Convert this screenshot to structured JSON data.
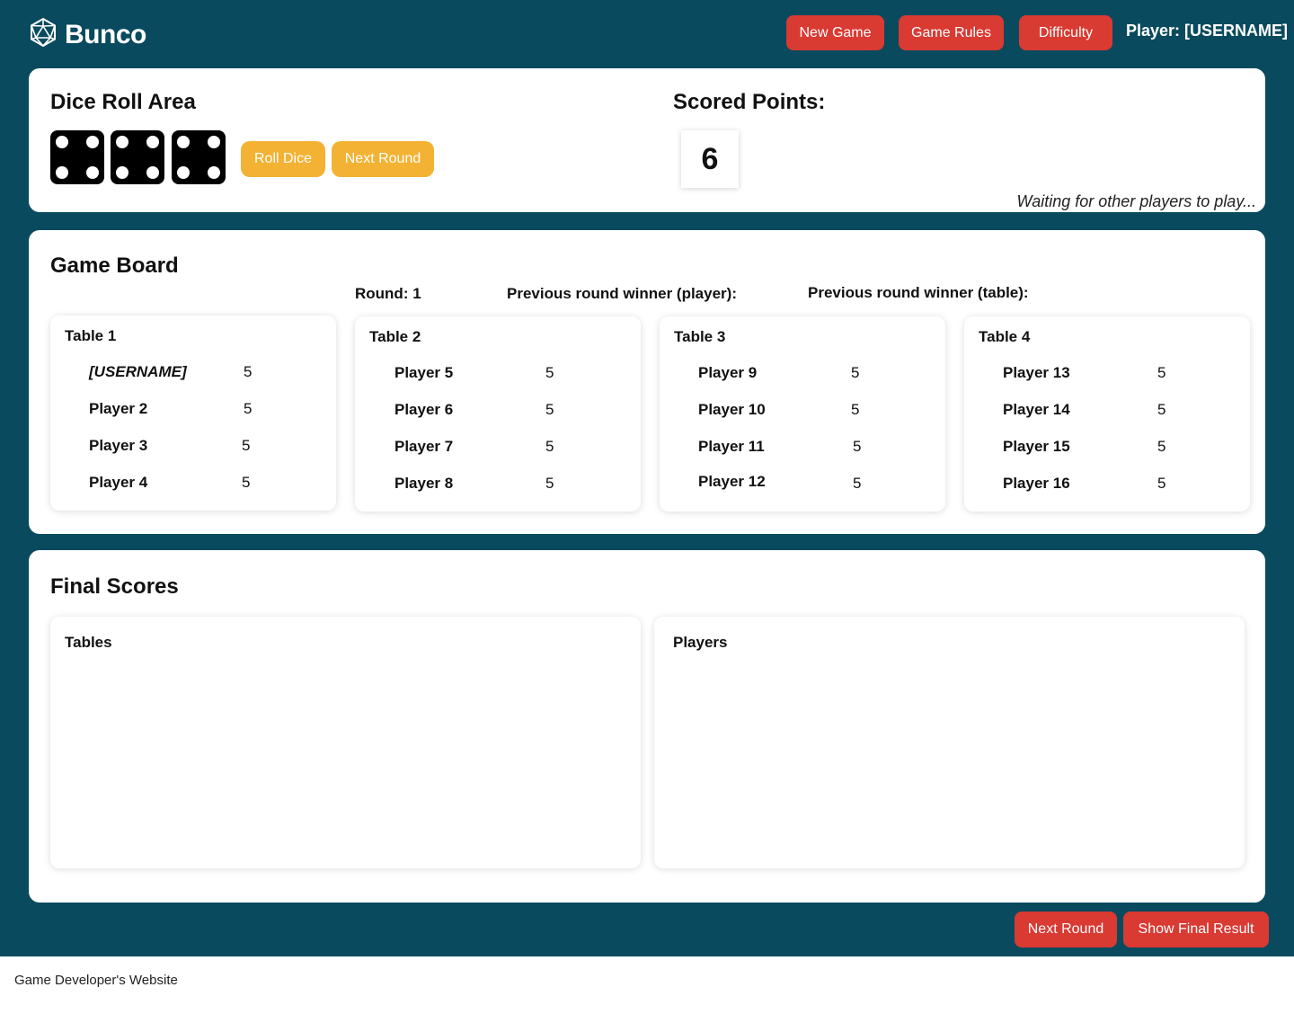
{
  "header": {
    "app_name": "Bunco",
    "logo_icon": "d20-dice-icon",
    "buttons": {
      "new_game": "New Game",
      "game_rules": "Game Rules",
      "difficulty": "Difficulty"
    },
    "player_label": "Player: [USERNAME]"
  },
  "dice_area": {
    "title": "Dice Roll Area",
    "dice": [
      4,
      4,
      4
    ],
    "roll_button": "Roll Dice",
    "next_round_button": "Next Round",
    "scored_title": "Scored Points:",
    "scored_value": "6",
    "status": "Waiting for other players to play..."
  },
  "game_board": {
    "title": "Game Board",
    "round_label": "Round: 1",
    "prev_winner_player_label": "Previous round winner (player):",
    "prev_winner_table_label": "Previous round winner (table):",
    "tables": [
      {
        "name": "Table 1",
        "players": [
          {
            "name": "[USERNAME]",
            "score": "5"
          },
          {
            "name": "Player 2",
            "score": "5"
          },
          {
            "name": "Player 3",
            "score": "5"
          },
          {
            "name": "Player 4",
            "score": "5"
          }
        ]
      },
      {
        "name": "Table 2",
        "players": [
          {
            "name": "Player 5",
            "score": "5"
          },
          {
            "name": "Player 6",
            "score": "5"
          },
          {
            "name": "Player 7",
            "score": "5"
          },
          {
            "name": "Player 8",
            "score": "5"
          }
        ]
      },
      {
        "name": "Table 3",
        "players": [
          {
            "name": "Player 9",
            "score": "5"
          },
          {
            "name": "Player 10",
            "score": "5"
          },
          {
            "name": "Player 11",
            "score": "5"
          },
          {
            "name": "Player 12",
            "score": "5"
          }
        ]
      },
      {
        "name": "Table 4",
        "players": [
          {
            "name": "Player 13",
            "score": "5"
          },
          {
            "name": "Player 14",
            "score": "5"
          },
          {
            "name": "Player 15",
            "score": "5"
          },
          {
            "name": "Player 16",
            "score": "5"
          }
        ]
      }
    ]
  },
  "final_scores": {
    "title": "Final Scores",
    "tables_label": "Tables",
    "players_label": "Players"
  },
  "bottom_buttons": {
    "next_round": "Next Round",
    "show_final": "Show Final Result"
  },
  "footer": {
    "link_text": "Game Developer's Website"
  },
  "colors": {
    "background": "#0a4a5e",
    "red_button": "#d93a32",
    "yellow_button": "#f3b233",
    "die": "#000000"
  }
}
